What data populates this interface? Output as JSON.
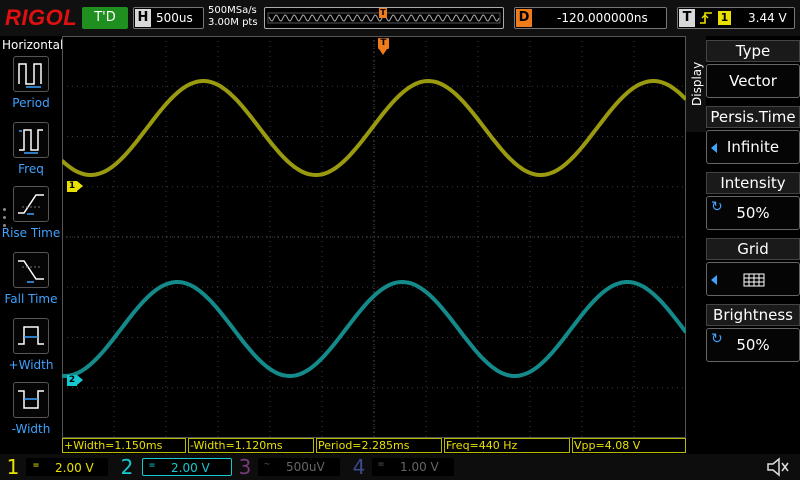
{
  "topbar": {
    "brand": "RIGOL",
    "run_state": "T'D",
    "timebase_key": "H",
    "timebase": "500us",
    "sample_rate": "500MSa/s",
    "memory_depth": "3.00M pts",
    "delay_key": "D",
    "delay": "-120.000000ns",
    "trigger_key": "T",
    "trigger_source": "1",
    "trigger_level": "3.44 V"
  },
  "left_menu": {
    "title": "Horizontal",
    "items": [
      {
        "label": "Period",
        "icon": "period-icon"
      },
      {
        "label": "Freq",
        "icon": "freq-icon"
      },
      {
        "label": "Rise Time",
        "icon": "rise-time-icon"
      },
      {
        "label": "Fall Time",
        "icon": "fall-time-icon"
      },
      {
        "label": "+Width",
        "icon": "positive-width-icon"
      },
      {
        "label": "-Width",
        "icon": "negative-width-icon"
      }
    ]
  },
  "right_menu": {
    "tab": "Display",
    "items": [
      {
        "label": "Type",
        "value": "Vector"
      },
      {
        "label": "Persis.Time",
        "value": "Infinite"
      },
      {
        "label": "Intensity",
        "value": "50%"
      },
      {
        "label": "Grid",
        "value": ""
      },
      {
        "label": "Brightness",
        "value": "50%"
      }
    ]
  },
  "measurements": [
    "+Width=1.150ms",
    "-Width=1.120ms",
    "Period=2.285ms",
    "Freq=440 Hz",
    "Vpp=4.08 V"
  ],
  "channels": [
    {
      "num": "1",
      "scale": "2.00 V",
      "color": "#e8e000",
      "active": true
    },
    {
      "num": "2",
      "scale": "2.00 V",
      "color": "#16c8d0",
      "active": true
    },
    {
      "num": "3",
      "scale": "500uV",
      "color": "#7a3a7a",
      "active": false
    },
    {
      "num": "4",
      "scale": "1.00 V",
      "color": "#3a4a8a",
      "active": false
    }
  ],
  "markers": {
    "ch1": "1",
    "ch2": "2",
    "trigger": "T"
  },
  "colors": {
    "ch1_trace": "#9a9a10",
    "ch2_trace": "#148a8a",
    "accent_blue": "#3fa3ff",
    "trigger_orange": "#f07b1a",
    "brand_red": "#e01010",
    "run_green": "#1f8f1f",
    "measurement_yellow": "#e8e000"
  },
  "waveforms": {
    "ch1": {
      "frequency_hz": 440
    },
    "ch2": {
      "frequency_hz": 440
    }
  }
}
